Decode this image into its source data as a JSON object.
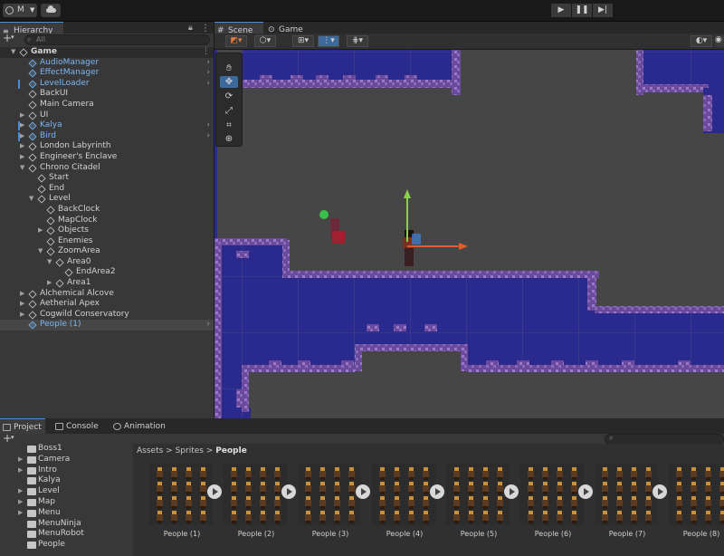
{
  "account": {
    "initial": "M"
  },
  "hierarchy": {
    "tab_label": "Hierarchy",
    "search_placeholder": "All",
    "rows": [
      {
        "label": "Game",
        "depth": 0,
        "kind": "scene",
        "expanded": true
      },
      {
        "label": "AudioManager",
        "depth": 1,
        "prefab": true,
        "chevron": true
      },
      {
        "label": "EffectManager",
        "depth": 1,
        "prefab": true,
        "chevron": true
      },
      {
        "label": "LevelLoader",
        "depth": 1,
        "prefab": true,
        "chevron": true,
        "mark": true
      },
      {
        "label": "BackUI",
        "depth": 1
      },
      {
        "label": "Main Camera",
        "depth": 1
      },
      {
        "label": "UI",
        "depth": 1,
        "collapsed": true
      },
      {
        "label": "Kalya",
        "depth": 1,
        "prefab": true,
        "collapsed": true,
        "chevron": true,
        "mark": true
      },
      {
        "label": "Bird",
        "depth": 1,
        "prefab": true,
        "collapsed": true,
        "chevron": true,
        "mark": true
      },
      {
        "label": "London Labyrinth",
        "depth": 1,
        "collapsed": true
      },
      {
        "label": "Engineer's Enclave",
        "depth": 1,
        "collapsed": true
      },
      {
        "label": "Chrono Citadel",
        "depth": 1,
        "expanded": true
      },
      {
        "label": "Start",
        "depth": 2
      },
      {
        "label": "End",
        "depth": 2
      },
      {
        "label": "Level",
        "depth": 2,
        "expanded": true
      },
      {
        "label": "BackClock",
        "depth": 3
      },
      {
        "label": "MapClock",
        "depth": 3
      },
      {
        "label": "Objects",
        "depth": 3,
        "collapsed": true
      },
      {
        "label": "Enemies",
        "depth": 3
      },
      {
        "label": "ZoomArea",
        "depth": 3,
        "expanded": true
      },
      {
        "label": "Area0",
        "depth": 4,
        "expanded": true
      },
      {
        "label": "EndArea2",
        "depth": 5
      },
      {
        "label": "Area1",
        "depth": 4,
        "collapsed": true
      },
      {
        "label": "Alchemical Alcove",
        "depth": 1,
        "collapsed": true
      },
      {
        "label": "Aetherial Apex",
        "depth": 1,
        "collapsed": true
      },
      {
        "label": "Cogwild Conservatory",
        "depth": 1,
        "collapsed": true
      },
      {
        "label": "People (1)",
        "depth": 1,
        "prefab": true,
        "selected": true,
        "chevron": true
      }
    ]
  },
  "scene": {
    "tabs": [
      {
        "label": "Scene",
        "active": true
      },
      {
        "label": "Game",
        "active": false
      }
    ]
  },
  "bottom": {
    "tabs": [
      {
        "label": "Project",
        "active": true
      },
      {
        "label": "Console"
      },
      {
        "label": "Animation"
      }
    ],
    "folders": [
      {
        "label": "Boss1"
      },
      {
        "label": "Camera",
        "collapsed": true
      },
      {
        "label": "Intro",
        "collapsed": true
      },
      {
        "label": "Kalya"
      },
      {
        "label": "Level",
        "collapsed": true
      },
      {
        "label": "Map",
        "collapsed": true
      },
      {
        "label": "Menu",
        "collapsed": true
      },
      {
        "label": "MenuNinja"
      },
      {
        "label": "MenuRobot"
      },
      {
        "label": "People"
      }
    ],
    "breadcrumb": {
      "root": "Assets",
      "mid": "Sprites",
      "last": "People",
      "sep": ">"
    },
    "assets": [
      "People (1)",
      "People (2)",
      "People (3)",
      "People (4)",
      "People (5)",
      "People (6)",
      "People (7)",
      "People (8)"
    ]
  }
}
